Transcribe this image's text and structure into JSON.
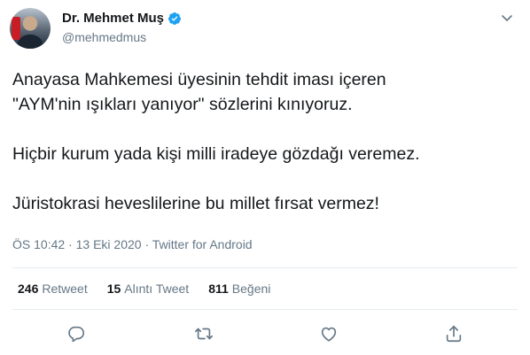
{
  "author": {
    "display_name": "Dr. Mehmet Muş",
    "handle": "@mehmedmus",
    "verified": true
  },
  "tweet": {
    "lines": [
      "Anayasa Mahkemesi üyesinin tehdit iması içeren",
      "\"AYM'nin ışıkları yanıyor\" sözlerini kınıyoruz.",
      "Hiçbir kurum yada kişi milli iradeye gözdağı veremez.",
      "Jüristokrasi heveslilerine bu millet fırsat vermez!"
    ],
    "time": "ÖS 10:42",
    "separator1": " · ",
    "date": "13 Eki 2020",
    "separator2": " · ",
    "source": "Twitter for Android"
  },
  "stats": {
    "retweets_count": "246",
    "retweets_label": "Retweet",
    "quotes_count": "15",
    "quotes_label": "Alıntı Tweet",
    "likes_count": "811",
    "likes_label": "Beğeni"
  },
  "icons": {
    "verified": "verified-badge-icon",
    "caret": "chevron-down-icon",
    "reply": "reply-icon",
    "retweet": "retweet-icon",
    "like": "heart-icon",
    "share": "share-icon"
  },
  "colors": {
    "accent": "#1da1f2",
    "text": "#14171a",
    "secondary": "#657786",
    "divider": "#e6ecf0"
  }
}
